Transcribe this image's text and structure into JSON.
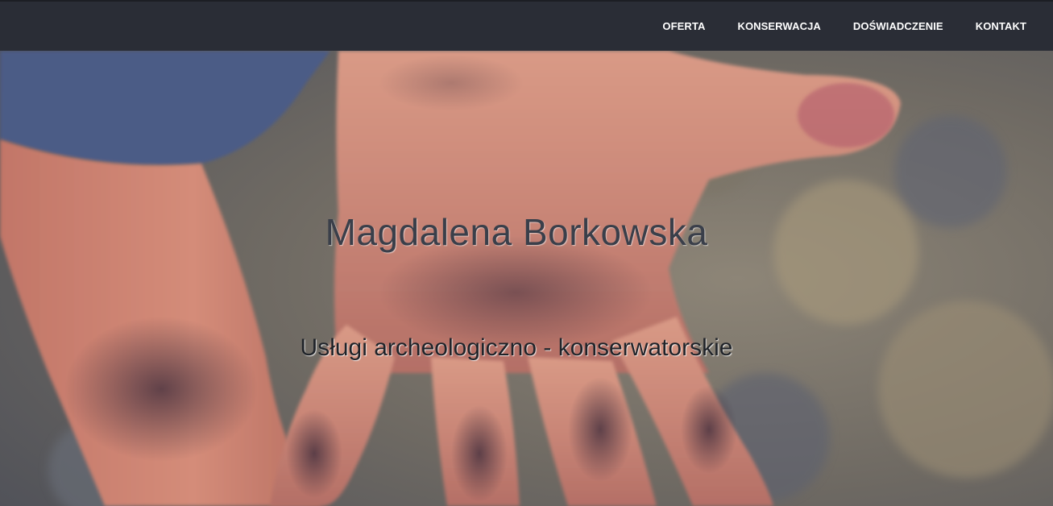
{
  "nav": {
    "items": [
      {
        "label": "OFERTA"
      },
      {
        "label": "KONSERWACJA"
      },
      {
        "label": "DOŚWIADCZENIE"
      },
      {
        "label": "KONTAKT"
      }
    ]
  },
  "hero": {
    "title": "Magdalena Borkowska",
    "subtitle": "Usługi archeologiczno - konserwatorskie",
    "background_description_icon": "dirty-hand-photo"
  },
  "colors": {
    "navbar_bg": "#2a2d36",
    "nav_text": "#ffffff",
    "title_text": "#3a3f4a",
    "subtitle_text": "#1f2329"
  }
}
